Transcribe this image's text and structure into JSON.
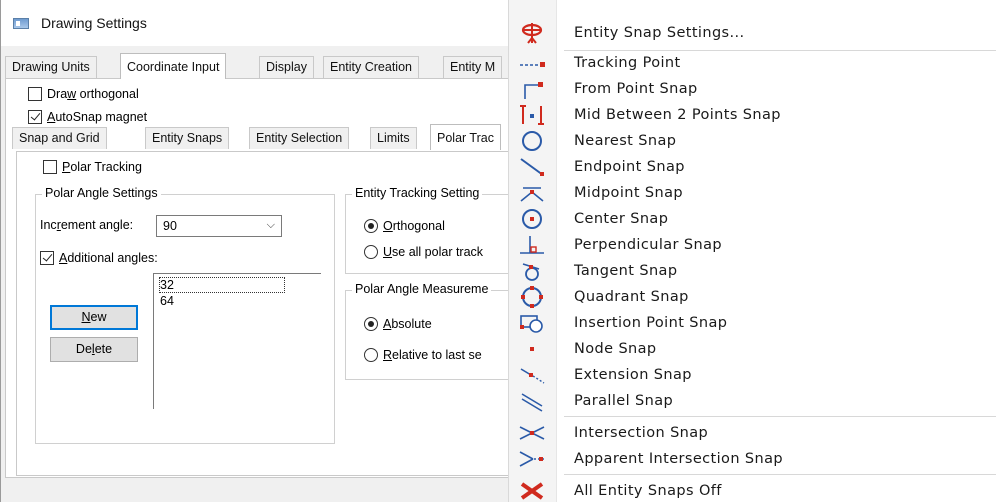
{
  "dialog": {
    "title": "Drawing Settings",
    "tabs": [
      "Drawing Units",
      "Coordinate Input",
      "Display",
      "Entity Creation",
      "Entity M"
    ],
    "draw_orthogonal": {
      "label_pre": "Dra",
      "label_u": "w",
      "label_post": " orthogonal",
      "checked": false
    },
    "autosnap_magnet": {
      "label_u": "A",
      "label_post": "utoSnap magnet",
      "checked": true
    },
    "subtabs": [
      "Snap and Grid",
      "Entity Snaps",
      "Entity Selection",
      "Limits",
      "Polar Trac"
    ],
    "polar_tracking": {
      "label_u": "P",
      "label_post": "olar Tracking",
      "checked": false
    },
    "polar_angle_settings": {
      "title": "Polar Angle Settings",
      "increment_label_pre": "Inc",
      "increment_label_u": "r",
      "increment_label_post": "ement angle:",
      "increment_value": "90",
      "additional_angles": {
        "label_u": "A",
        "label_post": "dditional angles:",
        "checked": true
      },
      "angles": [
        "32",
        "64"
      ],
      "new_button": {
        "label_u": "N",
        "label_post": "ew"
      },
      "delete_button": {
        "label_pre": "De",
        "label_u": "l",
        "label_post": "ete"
      }
    },
    "entity_tracking": {
      "title": "Entity Tracking Setting",
      "orthogonal": {
        "label_u": "O",
        "label_post": "rthogonal",
        "checked": true
      },
      "use_all": {
        "label_u": "U",
        "label_post": "se all polar track",
        "checked": false
      }
    },
    "polar_measurement": {
      "title": "Polar Angle Measureme",
      "absolute": {
        "label_u": "A",
        "label_post": "bsolute",
        "checked": true
      },
      "relative": {
        "label_u": "R",
        "label_post": "elative to last se",
        "checked": false
      }
    }
  },
  "menu": {
    "items": [
      {
        "label": "Entity Snap Settings...",
        "icon": "entity-snap-settings-icon"
      },
      {
        "label": "Tracking Point",
        "icon": "tracking-point-icon"
      },
      {
        "label": "From Point Snap",
        "icon": "from-point-snap-icon"
      },
      {
        "label": "Mid Between 2 Points Snap",
        "icon": "mid-between-points-icon"
      },
      {
        "label": "Nearest Snap",
        "icon": "nearest-snap-icon"
      },
      {
        "label": "Endpoint Snap",
        "icon": "endpoint-snap-icon"
      },
      {
        "label": "Midpoint Snap",
        "icon": "midpoint-snap-icon"
      },
      {
        "label": "Center Snap",
        "icon": "center-snap-icon"
      },
      {
        "label": "Perpendicular Snap",
        "icon": "perpendicular-snap-icon"
      },
      {
        "label": "Tangent Snap",
        "icon": "tangent-snap-icon"
      },
      {
        "label": "Quadrant Snap",
        "icon": "quadrant-snap-icon"
      },
      {
        "label": "Insertion Point Snap",
        "icon": "insertion-point-snap-icon"
      },
      {
        "label": "Node Snap",
        "icon": "node-snap-icon"
      },
      {
        "label": "Extension Snap",
        "icon": "extension-snap-icon"
      },
      {
        "label": "Parallel Snap",
        "icon": "parallel-snap-icon"
      },
      {
        "label": "Intersection Snap",
        "icon": "intersection-snap-icon"
      },
      {
        "label": "Apparent Intersection Snap",
        "icon": "apparent-intersection-snap-icon"
      },
      {
        "label": "All Entity Snaps Off",
        "icon": "all-snaps-off-icon"
      }
    ]
  },
  "colors": {
    "icon_red": "#d02a1e",
    "icon_blue": "#2a5aa8",
    "focus_blue": "#0078d7"
  }
}
